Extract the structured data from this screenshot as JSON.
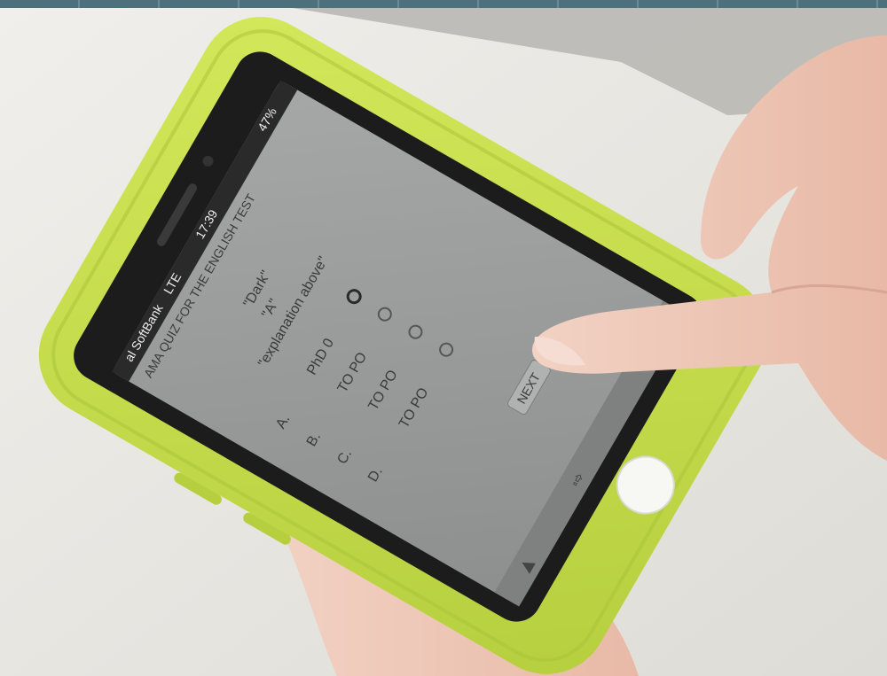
{
  "photo": {
    "subject": "hands-holding-smartphone",
    "colors": {
      "background": "#e9e8e3",
      "top_strip": "#4e6f7c",
      "case": "#c9e04a",
      "case_shadow": "#a9c23a",
      "screen": "#9a9c9c",
      "skin": "#f0c7b8"
    }
  },
  "phone_screen": {
    "status_bar": {
      "carrier": "al SoftBank",
      "network": "LTE",
      "time": "17:39",
      "battery": "47%"
    },
    "header_text": "AMA QUIZ FOR THE ENGLISH TEST",
    "question_lines": [
      "\"Dark\" ",
      "\"A\"",
      "\"explanation above\""
    ],
    "options": [
      {
        "label": "A.",
        "text": "PhD 0",
        "icon": "circle-icon"
      },
      {
        "label": "B.",
        "text": "TO PO",
        "icon": "circle-icon"
      },
      {
        "label": "C.",
        "text": "TO PO",
        "icon": "circle-icon"
      },
      {
        "label": "D.",
        "text": "TO PO",
        "icon": "circle-icon"
      }
    ],
    "button_label": "NEXT"
  }
}
